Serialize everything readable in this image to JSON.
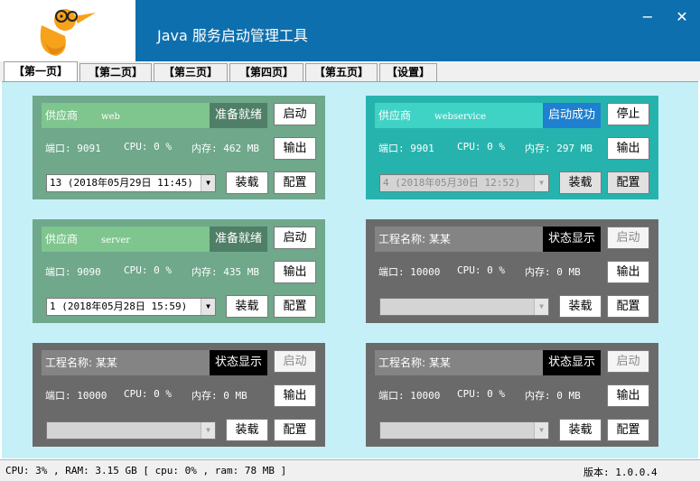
{
  "app": {
    "title": "Java 服务启动管理工具",
    "minimize": "−",
    "close": "✕"
  },
  "tabs": [
    {
      "label": "【第一页】"
    },
    {
      "label": "【第二页】"
    },
    {
      "label": "【第三页】"
    },
    {
      "label": "【第四页】"
    },
    {
      "label": "【第五页】"
    },
    {
      "label": "【设置】"
    }
  ],
  "panels": [
    {
      "header": "供应商",
      "sub": "web",
      "state": "准备就绪",
      "action": "启动",
      "port": "端口: 9091",
      "cpu": "CPU: 0 %",
      "mem": "内存: 462 MB",
      "output": "输出",
      "combo": "13 (2018年05月29日 11:45)",
      "load": "装载",
      "config": "配置",
      "colors": {
        "bg": "#6fa88b",
        "header": "#7ec58e",
        "state": "#4f7f66"
      }
    },
    {
      "header": "供应商",
      "sub": "webservice",
      "state": "启动成功",
      "action": "停止",
      "port": "端口: 9901",
      "cpu": "CPU: 0 %",
      "mem": "内存: 297 MB",
      "output": "输出",
      "combo": "4 (2018年05月30日 12:52)",
      "load": "装载",
      "config": "配置",
      "colors": {
        "bg": "#27b3ad",
        "header": "#3fd3c6",
        "state": "#1f7fd0"
      }
    },
    {
      "header": "供应商",
      "sub": "server",
      "state": "准备就绪",
      "action": "启动",
      "port": "端口: 9090",
      "cpu": "CPU: 0 %",
      "mem": "内存: 435 MB",
      "output": "输出",
      "combo": "1 (2018年05月28日 15:59)",
      "load": "装载",
      "config": "配置",
      "colors": {
        "bg": "#6fa88b",
        "header": "#7ec58e",
        "state": "#4f7f66"
      }
    },
    {
      "header": "工程名称: 某某",
      "sub": "",
      "state": "状态显示",
      "action": "启动",
      "port": "端口: 10000",
      "cpu": "CPU: 0 %",
      "mem": "内存: 0 MB",
      "output": "输出",
      "combo": "",
      "load": "装载",
      "config": "配置",
      "colors": {
        "bg": "#6b6a6b",
        "header": "#858485",
        "state": "#000000"
      }
    },
    {
      "header": "工程名称: 某某",
      "sub": "",
      "state": "状态显示",
      "action": "启动",
      "port": "端口: 10000",
      "cpu": "CPU: 0 %",
      "mem": "内存: 0 MB",
      "output": "输出",
      "combo": "",
      "load": "装载",
      "config": "配置",
      "colors": {
        "bg": "#6b6a6b",
        "header": "#858485",
        "state": "#000000"
      }
    },
    {
      "header": "工程名称: 某某",
      "sub": "",
      "state": "状态显示",
      "action": "启动",
      "port": "端口: 10000",
      "cpu": "CPU: 0 %",
      "mem": "内存: 0 MB",
      "output": "输出",
      "combo": "",
      "load": "装载",
      "config": "配置",
      "colors": {
        "bg": "#6b6a6b",
        "header": "#858485",
        "state": "#000000"
      }
    }
  ],
  "status": {
    "left": "CPU: 3% , RAM: 3.15 GB [ cpu: 0% , ram: 78 MB ]",
    "version": "版本: 1.0.0.4"
  }
}
